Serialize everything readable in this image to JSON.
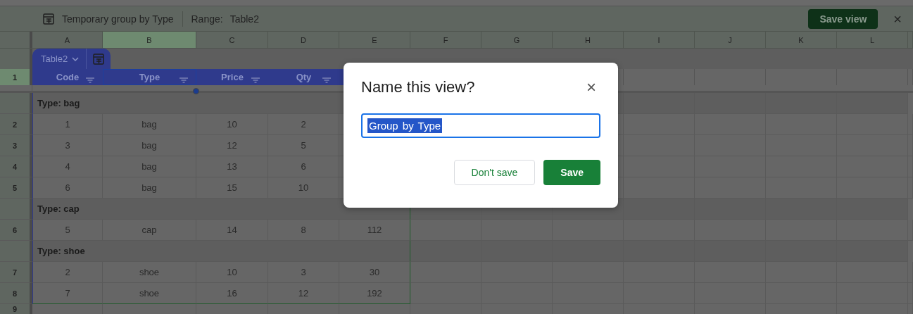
{
  "toolbar": {
    "title": "Temporary group by Type",
    "range_label": "Range:",
    "range_value": "Table2",
    "save_button": "Save view",
    "close": "×"
  },
  "columns": [
    {
      "label": "A",
      "selected": false
    },
    {
      "label": "B",
      "selected": true
    },
    {
      "label": "C",
      "selected": false
    },
    {
      "label": "D",
      "selected": false
    },
    {
      "label": "E",
      "selected": false
    },
    {
      "label": "F",
      "selected": false
    },
    {
      "label": "G",
      "selected": false
    },
    {
      "label": "H",
      "selected": false
    },
    {
      "label": "I",
      "selected": false
    },
    {
      "label": "J",
      "selected": false
    },
    {
      "label": "K",
      "selected": false
    },
    {
      "label": "L",
      "selected": false
    }
  ],
  "table": {
    "name": "Table2",
    "header_row_number": "1",
    "header": [
      {
        "label": "Code",
        "selected": false
      },
      {
        "label": "Type",
        "selected": true
      },
      {
        "label": "Price",
        "selected": false
      },
      {
        "label": "Qty",
        "selected": false
      }
    ],
    "groups": [
      {
        "label": "Type: bag",
        "rows": [
          {
            "row_number": "2",
            "cells": [
              "1",
              "bag",
              "10",
              "2"
            ]
          },
          {
            "row_number": "3",
            "cells": [
              "3",
              "bag",
              "12",
              "5"
            ]
          },
          {
            "row_number": "4",
            "cells": [
              "4",
              "bag",
              "13",
              "6"
            ]
          },
          {
            "row_number": "5",
            "cells": [
              "6",
              "bag",
              "15",
              "10"
            ]
          }
        ]
      },
      {
        "label": "Type: cap",
        "rows": [
          {
            "row_number": "6",
            "cells": [
              "5",
              "cap",
              "14",
              "8",
              "112"
            ]
          }
        ]
      },
      {
        "label": "Type: shoe",
        "rows": [
          {
            "row_number": "7",
            "cells": [
              "2",
              "shoe",
              "10",
              "3",
              "30"
            ]
          },
          {
            "row_number": "8",
            "cells": [
              "7",
              "shoe",
              "16",
              "12",
              "192"
            ]
          }
        ]
      }
    ]
  },
  "next_row_number": "9",
  "dialog": {
    "title": "Name this view?",
    "close": "×",
    "value": "Group by Type",
    "buttons": [
      {
        "label": "Don't save",
        "kind": "secondary"
      },
      {
        "label": "Save",
        "kind": "primary"
      }
    ]
  }
}
